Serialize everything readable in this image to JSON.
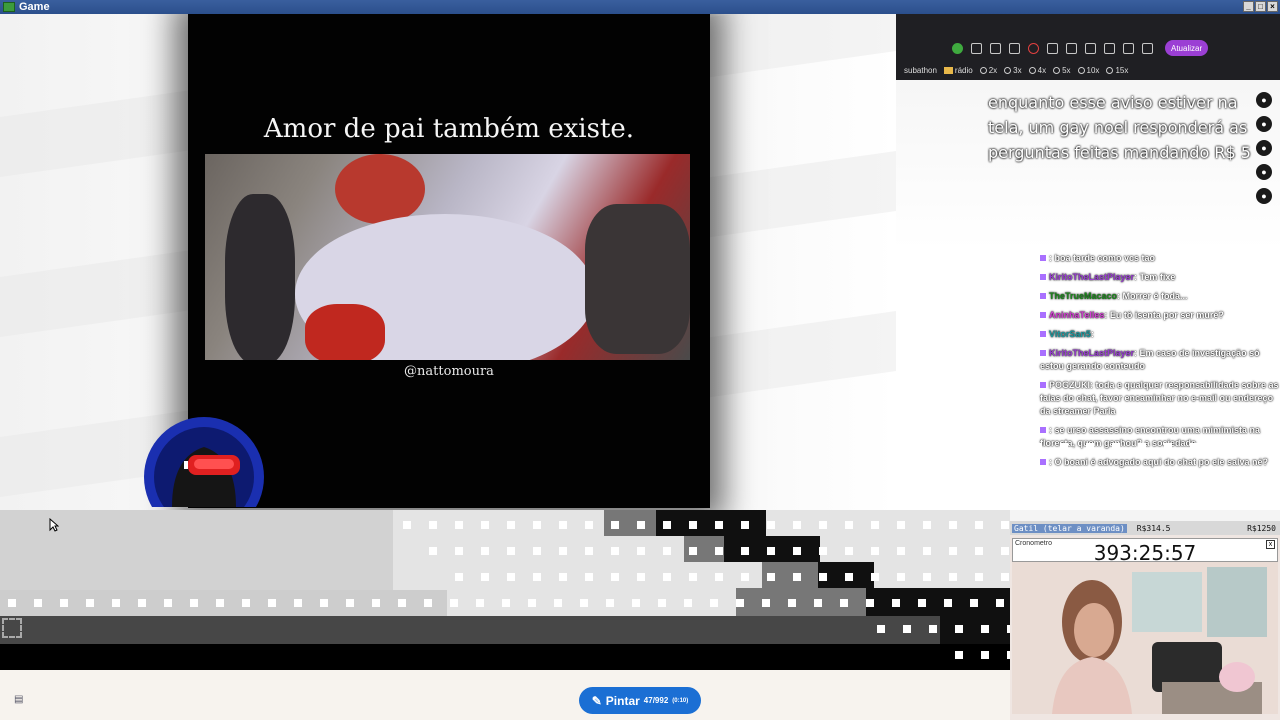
{
  "window": {
    "title": "Game"
  },
  "video": {
    "caption": "Amor de pai também existe.",
    "handle": "@nattomoura"
  },
  "browser": {
    "toolbar_badge": "5.47",
    "update_button": "Atualizar",
    "bookmarks": [
      "subathon",
      "rádio",
      "2x",
      "3x",
      "4x",
      "5x",
      "10x",
      "15x"
    ]
  },
  "stream": {
    "alert_text": "enquanto esse aviso estiver na tela, um gay noel responderá as perguntas feitas mandando R$ 5"
  },
  "chat": [
    {
      "user": "",
      "text": ": boa tarde como vcs tao",
      "user_color": "blue"
    },
    {
      "user": "KiritoTheLastPlayer",
      "text": ": Tem fixe",
      "user_color": "purple"
    },
    {
      "user": "TheTrueMacaco",
      "text": ": Morrer é foda...",
      "user_color": "green"
    },
    {
      "user": "AninhaTelles",
      "text": ": Eu tô isenta por ser muré?",
      "user_color": "pink"
    },
    {
      "user": "VitorSan5",
      "text": ":",
      "user_color": "teal"
    },
    {
      "user": "KiritoTheLastPlayer",
      "text": ": Em caso de investigação só estou gerando conteudo",
      "user_color": "purple"
    },
    {
      "user": "POGZUKI",
      "text": ": toda e qualquer responsabilidade sobre as falas do chat, favor encaminhar no e-mail ou endereço da streamer Parla",
      "user_color": "white"
    },
    {
      "user": "",
      "text": ": se urso assassino encontrou uma mimimista na floresta, quem ganhou? a sociedade",
      "user_color": "blue"
    },
    {
      "user": "",
      "text": ": O boani é advogado aqui do chat po ele salva né?",
      "user_color": "pink"
    }
  ],
  "overlay": {
    "goal_label": "Gatil (telar a varanda)",
    "goal_current": "R$314.5",
    "goal_target": "R$1250",
    "timer_title": "Cronometro",
    "timer": "393:25:57"
  },
  "paint": {
    "button_label": "Pintar",
    "count": "47/992",
    "cooldown": "(0:10)"
  },
  "colors": {
    "accent": "#1b6fd4",
    "update": "#9b3fd4"
  }
}
